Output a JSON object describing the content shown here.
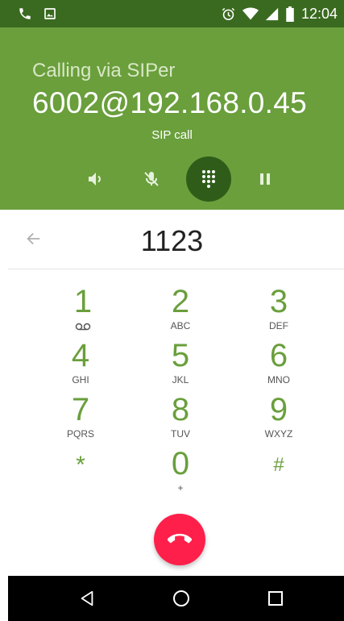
{
  "status_bar": {
    "time": "12:04",
    "left_icons": [
      "phone-icon",
      "image-icon"
    ],
    "right_icons": [
      "alarm-icon",
      "wifi-icon",
      "signal-icon",
      "battery-icon"
    ]
  },
  "call": {
    "calling_via": "Calling via SIPer",
    "number": "6002@192.168.0.45",
    "call_type": "SIP call",
    "controls": [
      "speaker-icon",
      "mute-icon",
      "dialpad-icon",
      "hold-icon"
    ],
    "header_color": "#6a9f3c",
    "accent_dark": "#2f5d19"
  },
  "dialer": {
    "digits": "1123",
    "keys": [
      {
        "num": "1",
        "letters": ""
      },
      {
        "num": "2",
        "letters": "ABC"
      },
      {
        "num": "3",
        "letters": "DEF"
      },
      {
        "num": "4",
        "letters": "GHI"
      },
      {
        "num": "5",
        "letters": "JKL"
      },
      {
        "num": "6",
        "letters": "MNO"
      },
      {
        "num": "7",
        "letters": "PQRS"
      },
      {
        "num": "8",
        "letters": "TUV"
      },
      {
        "num": "9",
        "letters": "WXYZ"
      },
      {
        "num": "*",
        "letters": ""
      },
      {
        "num": "0",
        "letters": "+"
      },
      {
        "num": "#",
        "letters": ""
      }
    ]
  },
  "end_call_color": "#ff1f4b",
  "nav_bar": [
    "back-icon",
    "home-icon",
    "recents-icon"
  ]
}
